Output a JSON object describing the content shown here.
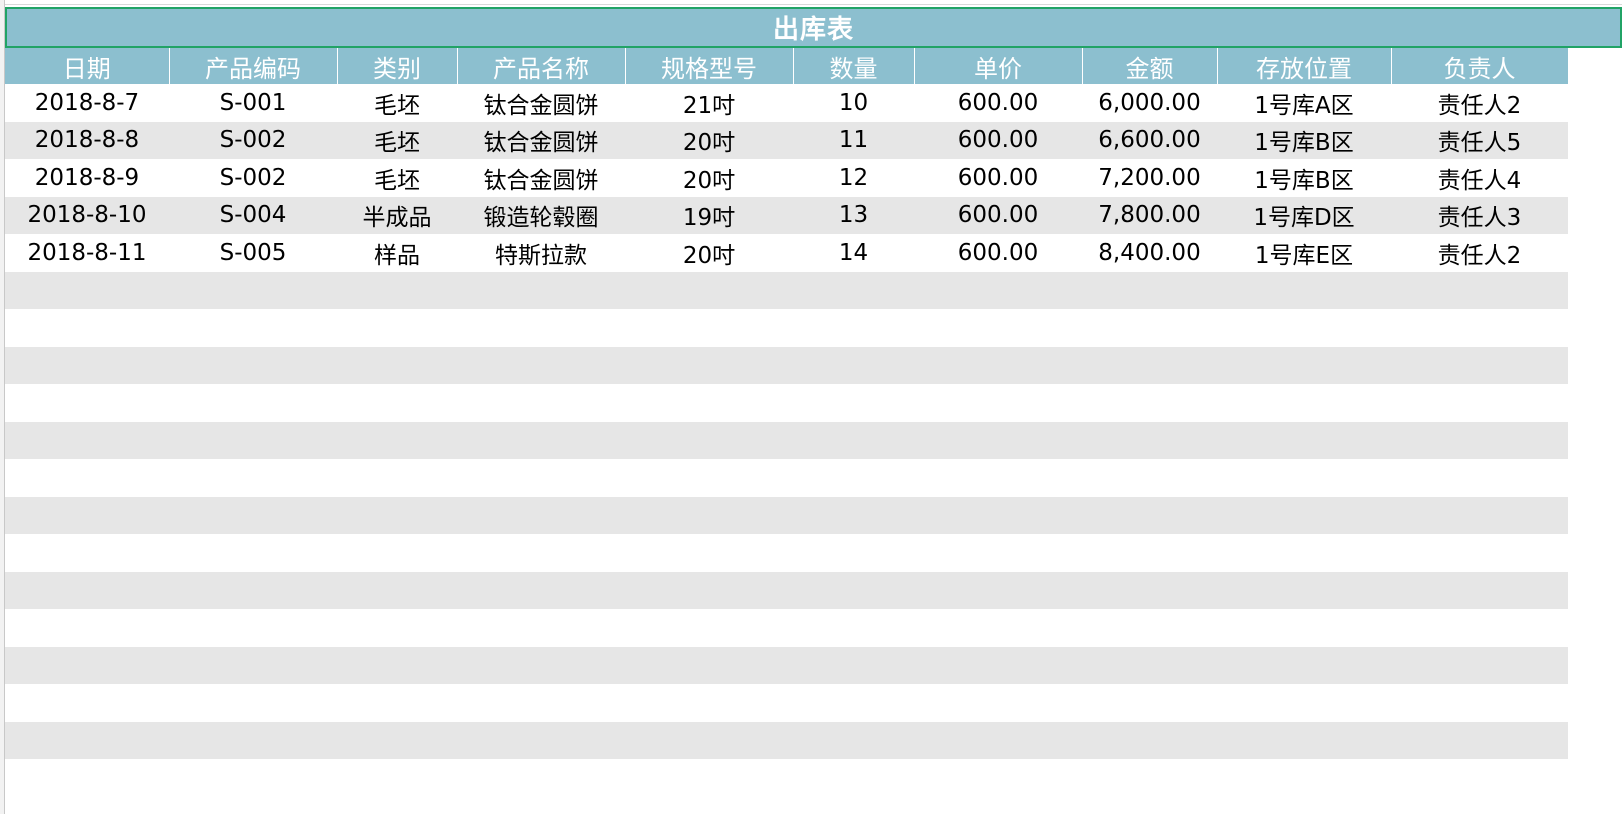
{
  "sheet": {
    "title": "出库表",
    "columns": [
      "日期",
      "产品编码",
      "类别",
      "产品名称",
      "规格型号",
      "数量",
      "单价",
      "金额",
      "存放位置",
      "负责人"
    ],
    "rows": [
      [
        "2018-8-7",
        "S-001",
        "毛坯",
        "钛合金圆饼",
        "21吋",
        "10",
        "600.00",
        "6,000.00",
        "1号库A区",
        "责任人2"
      ],
      [
        "2018-8-8",
        "S-002",
        "毛坯",
        "钛合金圆饼",
        "20吋",
        "11",
        "600.00",
        "6,600.00",
        "1号库B区",
        "责任人5"
      ],
      [
        "2018-8-9",
        "S-002",
        "毛坯",
        "钛合金圆饼",
        "20吋",
        "12",
        "600.00",
        "7,200.00",
        "1号库B区",
        "责任人4"
      ],
      [
        "2018-8-10",
        "S-004",
        "半成品",
        "锻造轮毂圈",
        "19吋",
        "13",
        "600.00",
        "7,800.00",
        "1号库D区",
        "责任人3"
      ],
      [
        "2018-8-11",
        "S-005",
        "样品",
        "特斯拉款",
        "20吋",
        "14",
        "600.00",
        "8,400.00",
        "1号库E区",
        "责任人2"
      ]
    ]
  },
  "colors": {
    "header_bg": "#8cbfcf",
    "header_text": "#ffffff",
    "band_odd": "#ffffff",
    "band_even": "#e6e6e6",
    "selection_border": "#21a366"
  }
}
